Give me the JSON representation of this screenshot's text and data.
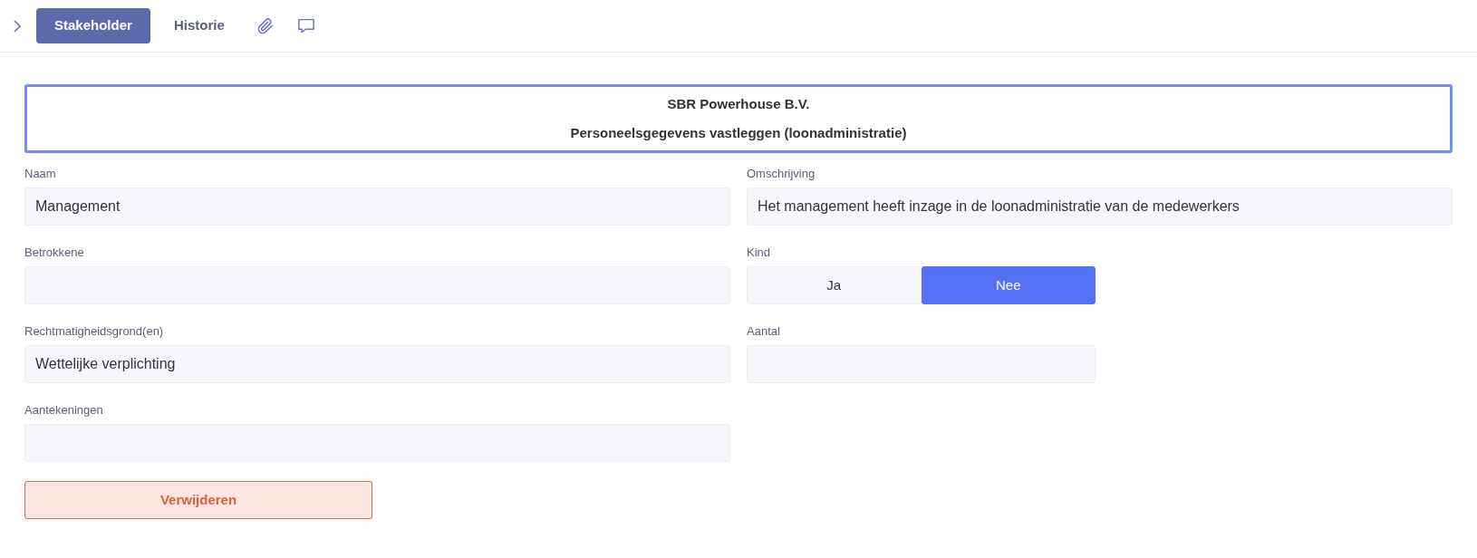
{
  "tabs": [
    {
      "kind": "text",
      "label": "Stakeholder",
      "selected": true
    },
    {
      "kind": "text",
      "label": "Historie",
      "selected": false
    },
    {
      "kind": "attachment",
      "selected": false
    },
    {
      "kind": "comment",
      "selected": false
    }
  ],
  "header": {
    "title": "SBR Powerhouse B.V.",
    "subtitle": "Personeelsgegevens vastleggen (loonadministratie)"
  },
  "left_fields": [
    {
      "kind": "text",
      "label": "Naam",
      "value": "Management"
    },
    {
      "kind": "text",
      "label": "Betrokkene"
    },
    {
      "kind": "text",
      "label": "Rechtmatigheidsgrond(en)",
      "value": "Wettelijke verplichting"
    },
    {
      "kind": "text",
      "label": "Aantekeningen"
    }
  ],
  "right_fields": [
    {
      "kind": "text",
      "label": "Omschrijving",
      "value": "Het management heeft inzage in de loonadministratie van de medewerkers"
    },
    {
      "kind": "toggle",
      "label": "Kind",
      "options": [
        {
          "label": "Ja",
          "selected": false
        },
        {
          "label": "Nee",
          "selected": true
        }
      ]
    },
    {
      "kind": "short",
      "label": "Aantal"
    }
  ],
  "delete_button": "Verwijderen"
}
